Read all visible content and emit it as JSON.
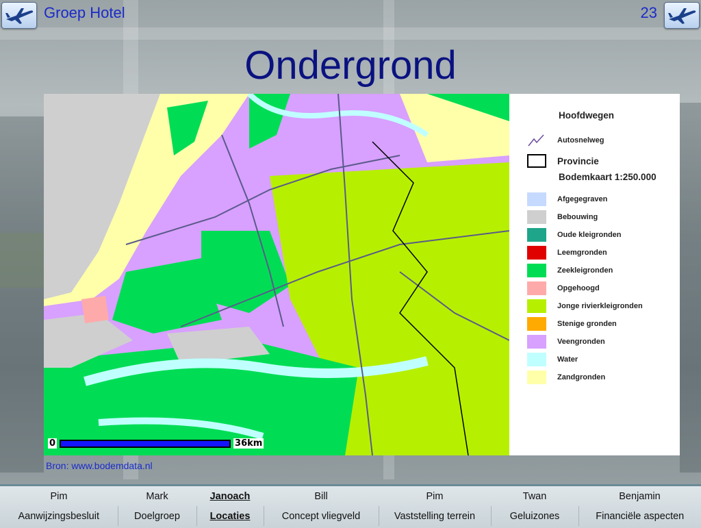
{
  "header": {
    "title": "Groep Hotel",
    "page_number": "23",
    "left_icon": "airplane-icon",
    "right_icon": "airplane-icon"
  },
  "slide": {
    "title": "Ondergrond"
  },
  "map": {
    "scale_start": "0",
    "scale_end": "36km"
  },
  "legend": {
    "roads_heading": "Hoofdwegen",
    "motorway_label": "Autosnelweg",
    "province_label": "Provincie",
    "soil_heading": "Bodemkaart 1:250.000",
    "items": [
      {
        "label": "Afgegegraven",
        "color": "#c6d9ff"
      },
      {
        "label": "Bebouwing",
        "color": "#cfcfcf"
      },
      {
        "label": "Oude kleigronden",
        "color": "#1fa58a"
      },
      {
        "label": "Leemgronden",
        "color": "#e00000"
      },
      {
        "label": "Zeekleigronden",
        "color": "#00dd55"
      },
      {
        "label": "Opgehoogd",
        "color": "#ffaaaa"
      },
      {
        "label": "Jonge rivierkleigronden",
        "color": "#b6f000"
      },
      {
        "label": "Stenige gronden",
        "color": "#ffaa00"
      },
      {
        "label": "Veengronden",
        "color": "#d8a0ff"
      },
      {
        "label": "Water",
        "color": "#c0ffff"
      },
      {
        "label": "Zandgronden",
        "color": "#ffffaa"
      }
    ]
  },
  "source": "Bron: www.bodemdata.nl",
  "nav": {
    "people": [
      "Pim",
      "Mark",
      "Janoach",
      "Bill",
      "Pim",
      "Twan",
      "Benjamin"
    ],
    "topics": [
      "Aanwijzingsbesluit",
      "Doelgroep",
      "Locaties",
      "Concept vliegveld",
      "Vaststelling terrein",
      "Geluizones",
      "Financiële aspecten"
    ],
    "active_index": 2
  }
}
